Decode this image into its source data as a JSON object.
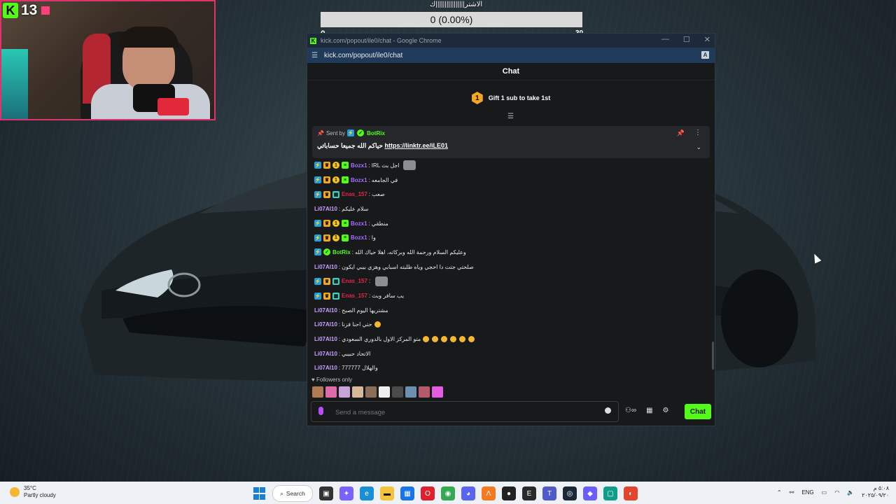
{
  "stream": {
    "k_logo": "K",
    "viewer_count": "13",
    "poll": {
      "title": "الاشتر||||||||||||||||ك",
      "value": "0 (0.00%)",
      "min": "0",
      "max": "30"
    }
  },
  "window": {
    "title": "kick.com/popout/ile0/chat - Google Chrome",
    "url": "kick.com/popout/ile0/chat",
    "min": "—",
    "max": "☐",
    "close": "✕"
  },
  "chat": {
    "header": "Chat",
    "gift_rank": "1",
    "gift_text": "Gift 1 sub to take 1st",
    "pinned": {
      "sent_by": "Sent by",
      "user": "BotRix",
      "text": "حياكم الله جميعا حساباتي",
      "link": "https://linktr.ee/iLE01"
    },
    "messages": [
      {
        "badges": [
          "vip",
          "crown",
          "one",
          "green"
        ],
        "user": "Bozx1",
        "text": "IRL اجل بث",
        "emote": true,
        "uclass": "u-bozx"
      },
      {
        "badges": [
          "vip",
          "crown",
          "one",
          "green"
        ],
        "user": "Bozx1",
        "text": "في الجامعه",
        "uclass": "u-bozx"
      },
      {
        "badges": [
          "vip",
          "crown",
          "tile"
        ],
        "user": "Enas_157",
        "text": "صعب",
        "uclass": "u-enas"
      },
      {
        "badges": [],
        "user": "Li07Al10",
        "text": "سلام عليكم",
        "uclass": "u-li"
      },
      {
        "badges": [
          "vip",
          "crown",
          "one",
          "green"
        ],
        "user": "Bozx1",
        "text": "منطقي",
        "uclass": "u-bozx"
      },
      {
        "badges": [
          "vip",
          "crown",
          "one",
          "green"
        ],
        "user": "Bozx1",
        "text": "وا",
        "uclass": "u-bozx"
      },
      {
        "badges": [
          "vip",
          "bot"
        ],
        "user": "BotRix",
        "text": "وعليكم السلام ورحمة الله وبركاته، اهلا حياك الله",
        "uclass": "u-bot"
      },
      {
        "badges": [],
        "user": "Li07Al10",
        "text": "صلحتي جتت دا احجي وياه طلبته اسبابي وهزي بيبي ايكون",
        "uclass": "u-li"
      },
      {
        "badges": [
          "vip",
          "crown",
          "tile"
        ],
        "user": "Enas_157",
        "text": "",
        "emote": true,
        "uclass": "u-enas"
      },
      {
        "badges": [
          "vip",
          "crown",
          "tile"
        ],
        "user": "Enas_157",
        "text": "يب سافر وبث",
        "uclass": "u-enas"
      },
      {
        "badges": [],
        "user": "Li07Al10",
        "text": "مشتريها اليوم الصبح",
        "uclass": "u-li"
      },
      {
        "badges": [],
        "user": "Li07Al10",
        "text": "حتي احنا فزنا",
        "emojis": 1,
        "uclass": "u-li"
      },
      {
        "badges": [],
        "user": "Li07Al10",
        "text": "متو المركز الاول بالدوري السعودي",
        "emojis": 6,
        "uclass": "u-li"
      },
      {
        "badges": [],
        "user": "Li07Al10",
        "text": "الاتحاد حبيبي",
        "uclass": "u-li"
      },
      {
        "badges": [],
        "user": "Li07Al10",
        "text": "777777 والهلال",
        "uclass": "u-li"
      }
    ],
    "followers_only": "Followers only",
    "input_placeholder": "Send a message",
    "send_label": "Chat"
  },
  "taskbar": {
    "temp": "35°C",
    "condition": "Partly cloudy",
    "search": "Search",
    "lang": "ENG",
    "time": "٥:٠٨ م",
    "date": "٢٠٢٥/٠٩/٢٠"
  },
  "colors": {
    "kick_green": "#53fc18",
    "chat_bg": "#18191b",
    "chrome_titlebar": "#1c2a3a"
  }
}
